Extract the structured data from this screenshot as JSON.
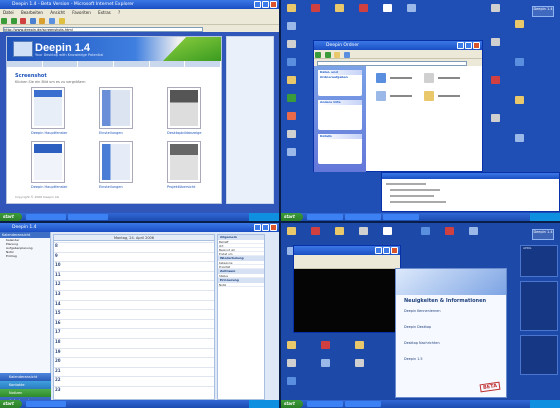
{
  "browser": {
    "window_title": "Deepin 1.4 - Beta Version - Microsoft Internet Explorer",
    "menu": [
      "Datei",
      "Bearbeiten",
      "Ansicht",
      "Favoriten",
      "Extras",
      "?"
    ],
    "address": "http://www.deepin.de/screenshots.html"
  },
  "site": {
    "logo": "Deepin 1.4",
    "tagline": "Your Desktop with Knowledge Potential",
    "section_title": "Screenshot",
    "section_subtitle": "Klicken Sie ein Bild um es zu vergrößern",
    "thumbs": [
      {
        "label": "Deepin Hauptfenster"
      },
      {
        "label": "Einstellungen"
      },
      {
        "label": "Desktopbildanzeige"
      },
      {
        "label": "Deepin Hauptfenster"
      },
      {
        "label": "Einstellungen"
      },
      {
        "label": "Projektübersicht"
      }
    ],
    "copyright": "Copyright © 2006 Deepin AG"
  },
  "explorer": {
    "window_title": "Deepin Ordner",
    "task_title": "Datei- und Ordneraufgaben",
    "other_title": "Andere Orte",
    "details_title": "Details"
  },
  "calendar": {
    "app_title": "Deepin 1.4",
    "sidebar_title": "Kalenderansicht",
    "sidebar_items": [
      "Kalender",
      "Planung",
      "Aufgabenplanung",
      "Notiz",
      "Eintrag"
    ],
    "nav": [
      "Kalenderansicht",
      "Kontakte",
      "Notizen",
      "Aufgabenplanung"
    ],
    "day_header": "Montag, 24. April 2006",
    "hours": [
      "8",
      "9",
      "10",
      "11",
      "12",
      "13",
      "14",
      "15",
      "16",
      "17",
      "18",
      "19",
      "20",
      "21",
      "22",
      "23"
    ],
    "props_sections": [
      "Allgemein",
      "Wiederholung",
      "Zeitraum",
      "Erinnerung"
    ],
    "props_rows": [
      "Betreff",
      "Ort",
      "Beginnt um",
      "Endet um",
      "Kategorie",
      "Priorität",
      "Status",
      "Notiz"
    ]
  },
  "desktop": {
    "logo": "Deepin 1.4",
    "welcome_title": "Neuigkeiten & Informationen",
    "welcome_items": [
      "Deepin Kennenlernen",
      "Deepin Desktop",
      "Desktop Nachrichten",
      "Deepin 1.5"
    ],
    "beta_label": "BETA",
    "date_label": "APRIL",
    "start_label": "start"
  }
}
